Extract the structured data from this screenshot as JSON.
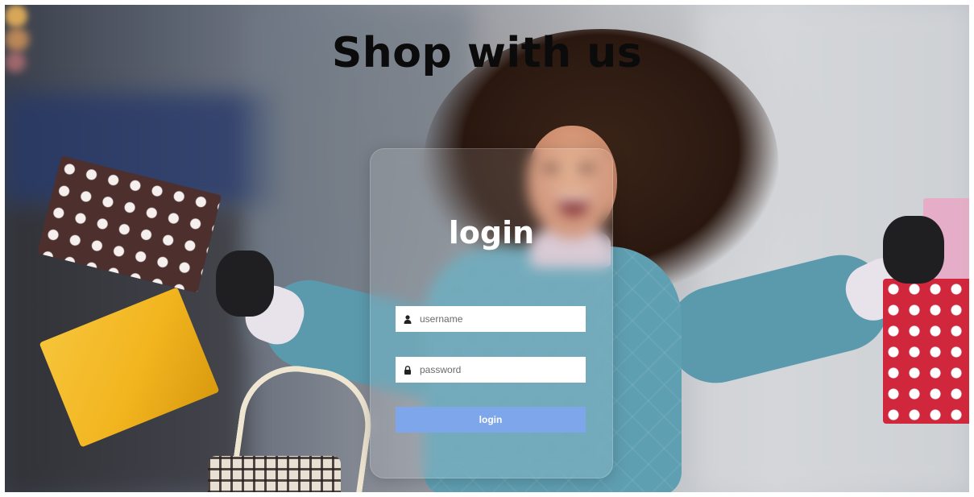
{
  "header": {
    "title": "Shop with us"
  },
  "login_form": {
    "title": "login",
    "username": {
      "placeholder": "username",
      "value": "",
      "icon": "user-icon"
    },
    "password": {
      "placeholder": "password",
      "value": "",
      "icon": "lock-icon"
    },
    "submit_label": "login",
    "button_color": "#7ea6ea"
  },
  "colors": {
    "title_text": "#0b0b0b",
    "card_title": "#ffffff"
  }
}
